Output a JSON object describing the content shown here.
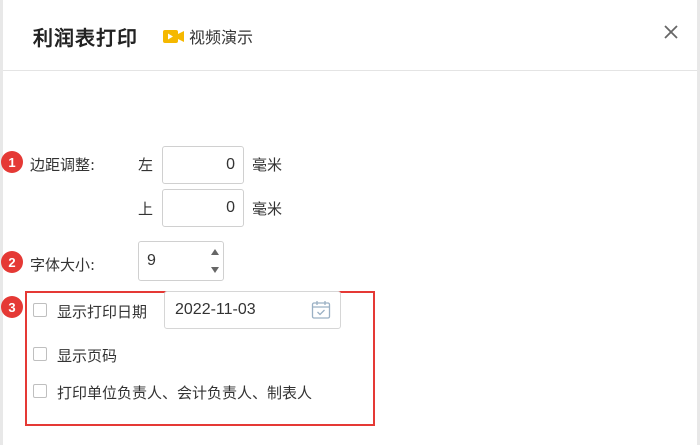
{
  "dialog": {
    "title": "利润表打印",
    "video_link": "视频演示",
    "close_symbol": "×"
  },
  "margin_section": {
    "badge": "1",
    "label": "边距调整:",
    "left": {
      "label": "左",
      "value": "0",
      "unit": "毫米"
    },
    "top": {
      "label": "上",
      "value": "0",
      "unit": "毫米"
    }
  },
  "font_section": {
    "badge": "2",
    "label": "字体大小:",
    "value": "9"
  },
  "options_section": {
    "badge": "3",
    "show_print_date": {
      "label": "显示打印日期",
      "checked": false,
      "date": "2022-11-03"
    },
    "show_page_number": {
      "label": "显示页码",
      "checked": false
    },
    "print_signers": {
      "label": "打印单位负责人、会计负责人、制表人",
      "checked": false
    }
  },
  "colors": {
    "badge": "#e53935",
    "highlight_border": "#e53935",
    "video_icon": "#f5b800"
  },
  "icons": {
    "video": "video-play-icon",
    "close": "close-icon",
    "calendar": "calendar-icon",
    "spinner": "spinner-arrows-icon"
  }
}
